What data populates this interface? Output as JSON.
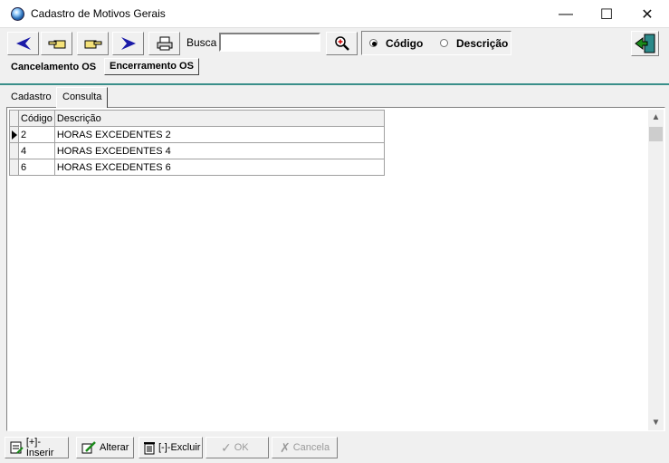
{
  "window": {
    "title": "Cadastro de Motivos Gerais",
    "minimize": "—",
    "maximize": "☐",
    "close": "✕"
  },
  "toolbar": {
    "busca_label": "Busca",
    "busca_value": "",
    "radio_codigo": "Código",
    "radio_descricao": "Descrição",
    "selected": "Código"
  },
  "top_tabs": [
    "Cancelamento OS",
    "Encerramento OS"
  ],
  "inner_tabs": [
    "Cadastro",
    "Consulta"
  ],
  "grid": {
    "headers": [
      "Código",
      "Descrição"
    ],
    "rows": [
      {
        "codigo": "2",
        "descricao": "HORAS EXCEDENTES 2"
      },
      {
        "codigo": "4",
        "descricao": "HORAS EXCEDENTES 4"
      },
      {
        "codigo": "6",
        "descricao": "HORAS EXCEDENTES 6"
      }
    ]
  },
  "buttons": {
    "inserir": "[+]-Inserir",
    "alterar": "Alterar",
    "excluir": "[-]-Excluir",
    "ok": "OK",
    "cancela": "Cancela"
  },
  "colors": {
    "accent": "#3a8f8a",
    "nav_arrow": "#1a1aa8"
  }
}
